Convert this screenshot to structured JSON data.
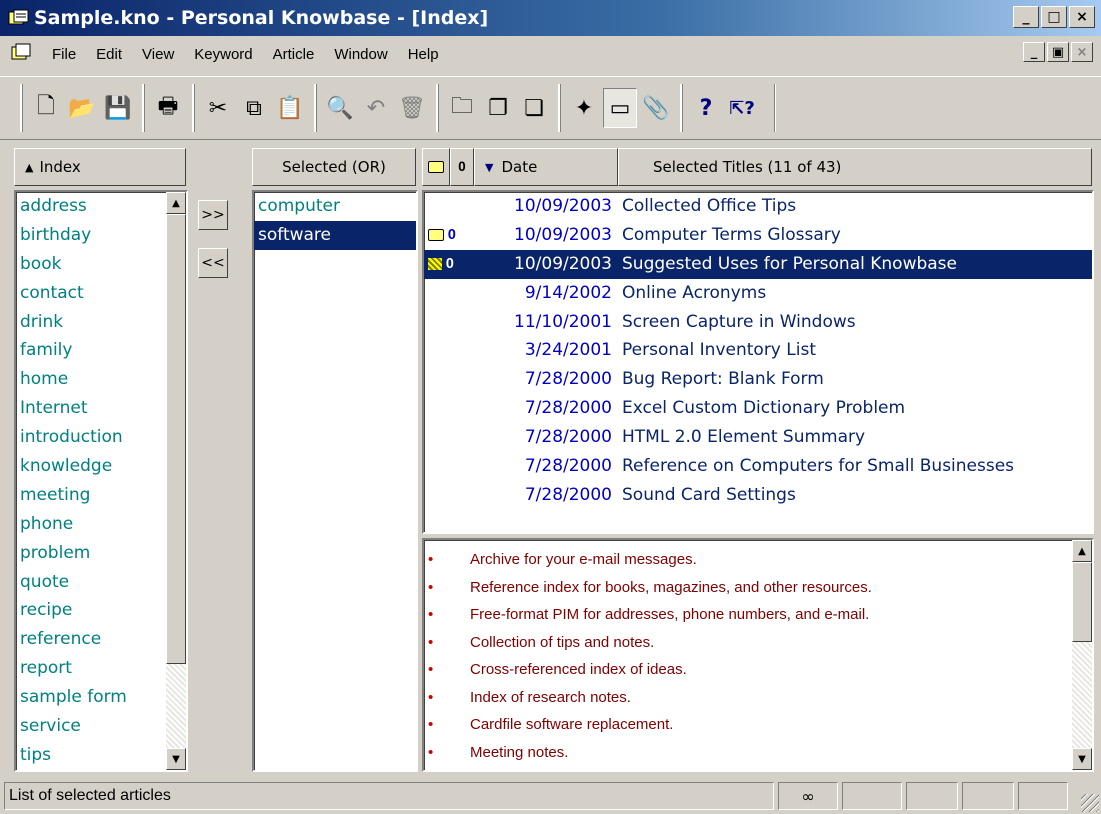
{
  "window": {
    "title": "Sample.kno - Personal Knowbase - [Index]",
    "min_label": "_",
    "max_label": "□",
    "close_label": "×"
  },
  "menu": {
    "items": [
      {
        "label": "File"
      },
      {
        "label": "Edit"
      },
      {
        "label": "View"
      },
      {
        "label": "Keyword"
      },
      {
        "label": "Article"
      },
      {
        "label": "Window"
      },
      {
        "label": "Help"
      }
    ],
    "mdi_min": "_",
    "mdi_restore": "▣",
    "mdi_close": "×"
  },
  "toolbar": {
    "buttons": [
      {
        "icon": "new-document-icon",
        "glyph": "🗋"
      },
      {
        "icon": "open-folder-icon",
        "glyph": "📂"
      },
      {
        "icon": "save-icon",
        "glyph": "💾"
      },
      {
        "icon": "print-icon",
        "glyph": "🖶"
      },
      {
        "icon": "cut-icon",
        "glyph": "✂"
      },
      {
        "icon": "copy-icon",
        "glyph": "⧉"
      },
      {
        "icon": "paste-icon",
        "glyph": "📋"
      },
      {
        "icon": "find-icon",
        "glyph": "🔍"
      },
      {
        "icon": "undo-icon",
        "glyph": "↶"
      },
      {
        "icon": "delete-icon",
        "glyph": "🗑"
      },
      {
        "icon": "new-folder-icon",
        "glyph": "🗀"
      },
      {
        "icon": "duplicate-article-icon",
        "glyph": "❐"
      },
      {
        "icon": "article-group-icon",
        "glyph": "❏"
      },
      {
        "icon": "new-keyword-icon",
        "glyph": "✦"
      },
      {
        "icon": "toggle-folder-icon",
        "glyph": "▭"
      },
      {
        "icon": "attachment-icon",
        "glyph": "📎"
      },
      {
        "icon": "help-icon",
        "glyph": "?"
      },
      {
        "icon": "context-help-icon",
        "glyph": "⇱?"
      }
    ]
  },
  "index_panel": {
    "header": "Index",
    "sort_glyph": "▲",
    "keywords": [
      "address",
      "birthday",
      "book",
      "contact",
      "drink",
      "family",
      "home",
      "Internet",
      "introduction",
      "knowledge",
      "meeting",
      "phone",
      "problem",
      "quote",
      "recipe",
      "reference",
      "report",
      "sample form",
      "service",
      "tips"
    ]
  },
  "move_buttons": {
    "add": ">>",
    "remove": "<<"
  },
  "selected_panel": {
    "header": "Selected (OR)",
    "keywords": [
      "computer",
      "software"
    ]
  },
  "titles_panel": {
    "date_header": "Date",
    "titles_header": "Selected Titles (11 of 43)",
    "rows": [
      {
        "date": "10/09/2003",
        "title": "Collected Office Tips",
        "folder": false,
        "clip": false
      },
      {
        "date": "10/09/2003",
        "title": "Computer Terms Glossary",
        "folder": true,
        "clip": true
      },
      {
        "date": "10/09/2003",
        "title": "Suggested Uses for Personal Knowbase",
        "folder": true,
        "clip": true
      },
      {
        "date": "9/14/2002",
        "title": "Online Acronyms",
        "folder": false,
        "clip": false
      },
      {
        "date": "11/10/2001",
        "title": "Screen Capture in Windows",
        "folder": false,
        "clip": false
      },
      {
        "date": "3/24/2001",
        "title": "Personal Inventory List",
        "folder": false,
        "clip": false
      },
      {
        "date": "7/28/2000",
        "title": "Bug Report: Blank Form",
        "folder": false,
        "clip": false
      },
      {
        "date": "7/28/2000",
        "title": "Excel Custom Dictionary Problem",
        "folder": false,
        "clip": false
      },
      {
        "date": "7/28/2000",
        "title": "HTML 2.0 Element Summary",
        "folder": false,
        "clip": false
      },
      {
        "date": "7/28/2000",
        "title": "Reference on Computers for Small Businesses",
        "folder": false,
        "clip": false
      },
      {
        "date": "7/28/2000",
        "title": "Sound Card Settings",
        "folder": false,
        "clip": false
      }
    ]
  },
  "preview": {
    "bullet": "•",
    "lines": [
      "Archive for your e-mail messages.",
      "Reference index for books, magazines, and other resources.",
      "Free-format PIM for addresses, phone numbers, and e-mail.",
      "Collection of tips and notes.",
      "Cross-referenced index of ideas.",
      "Index of research notes.",
      "Cardfile software replacement.",
      "Meeting notes."
    ]
  },
  "status": {
    "text": "List of selected articles",
    "link_glyph": "∞"
  },
  "colors": {
    "selection": "#0a246a",
    "keyword_text": "#008080",
    "date_text": "#0000c0",
    "preview_text": "#800000"
  }
}
